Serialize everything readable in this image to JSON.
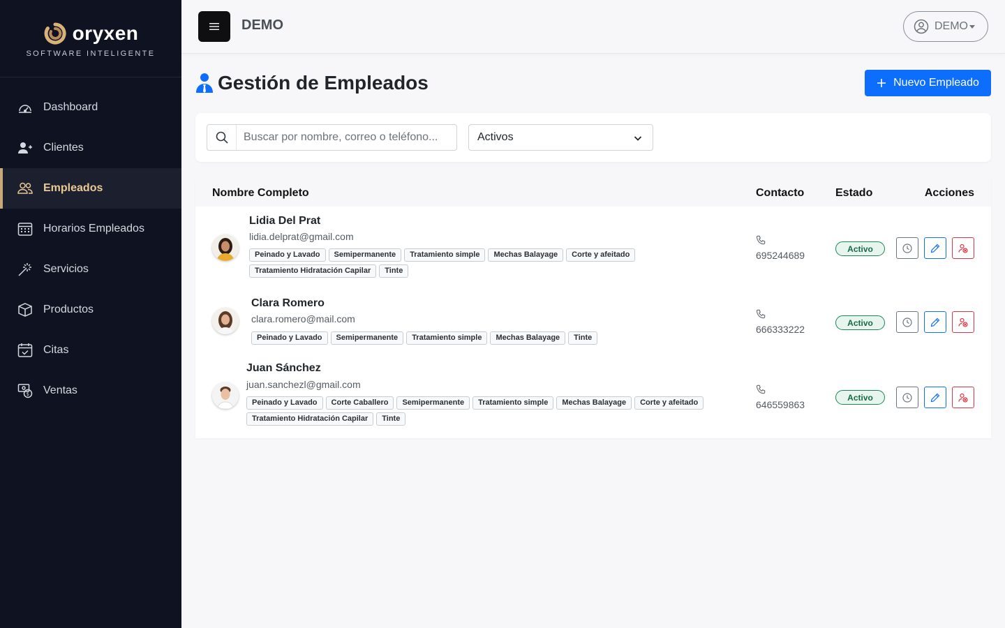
{
  "brand": {
    "name": "oryxen",
    "tagline": "SOFTWARE INTELIGENTE"
  },
  "sidebar": {
    "items": [
      {
        "label": "Dashboard",
        "icon": "speedometer-icon",
        "active": false
      },
      {
        "label": "Clientes",
        "icon": "person-add-icon",
        "active": false
      },
      {
        "label": "Empleados",
        "icon": "people-icon",
        "active": true
      },
      {
        "label": "Horarios Empleados",
        "icon": "calendar-week-icon",
        "active": false
      },
      {
        "label": "Servicios",
        "icon": "magic-wand-icon",
        "active": false
      },
      {
        "label": "Productos",
        "icon": "box-icon",
        "active": false
      },
      {
        "label": "Citas",
        "icon": "calendar-check-icon",
        "active": false
      },
      {
        "label": "Ventas",
        "icon": "cash-coin-icon",
        "active": false
      }
    ]
  },
  "topbar": {
    "title": "DEMO",
    "user_label": "DEMO"
  },
  "page": {
    "title": "Gestión de Empleados",
    "new_button": "Nuevo Empleado"
  },
  "filters": {
    "search_placeholder": "Buscar por nombre, correo o teléfono...",
    "status_selected": "Activos"
  },
  "table": {
    "headers": {
      "name": "Nombre Completo",
      "contact": "Contacto",
      "status": "Estado",
      "actions": "Acciones"
    },
    "rows": [
      {
        "name": "Lidia Del Prat",
        "email": "lidia.delprat@gmail.com",
        "phone": "695244689",
        "status": "Activo",
        "services": [
          "Peinado y Lavado",
          "Semipermanente",
          "Tratamiento simple",
          "Mechas Balayage",
          "Corte y afeitado",
          "Tratamiento Hidratación Capilar",
          "Tinte"
        ]
      },
      {
        "name": "Clara Romero",
        "email": "clara.romero@mail.com",
        "phone": "666333222",
        "status": "Activo",
        "services": [
          "Peinado y Lavado",
          "Semipermanente",
          "Tratamiento simple",
          "Mechas Balayage",
          "Tinte"
        ]
      },
      {
        "name": "Juan Sánchez",
        "email": "juan.sanchezl@gmail.com",
        "phone": "646559863",
        "status": "Activo",
        "services": [
          "Peinado y Lavado",
          "Corte Caballero",
          "Semipermanente",
          "Tratamiento simple",
          "Mechas Balayage",
          "Corte y afeitado",
          "Tratamiento Hidratación Capilar",
          "Tinte"
        ]
      }
    ]
  },
  "colors": {
    "sidebar_bg": "#0f1220",
    "accent_gold": "#c9a87a",
    "primary": "#0d6efd",
    "success": "#198754",
    "danger": "#dc3545"
  }
}
